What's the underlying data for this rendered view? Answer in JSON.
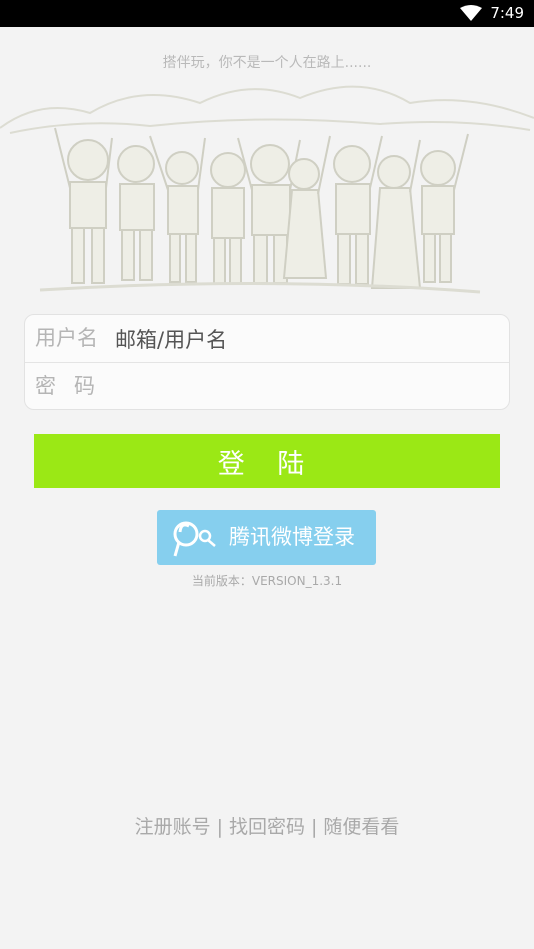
{
  "status_bar": {
    "time": "7:49",
    "icons": [
      "wifi-icon"
    ]
  },
  "header": {
    "tagline": "搭伴玩，你不是一个人在路上......"
  },
  "login_form": {
    "username_label": "用户名",
    "username_placeholder": "邮箱/用户名",
    "password_label": "密码"
  },
  "actions": {
    "login_label": "登 陆",
    "weibo_login_label": "腾讯微博登录"
  },
  "version_text": "当前版本：VERSION_1.3.1",
  "footer": {
    "register": "注册账号",
    "separator": "|",
    "find_password": "找回密码",
    "browse": "随便看看"
  },
  "colors": {
    "login_button": "#9be815",
    "weibo_button": "#86cfee",
    "background": "#f3f3f3"
  }
}
